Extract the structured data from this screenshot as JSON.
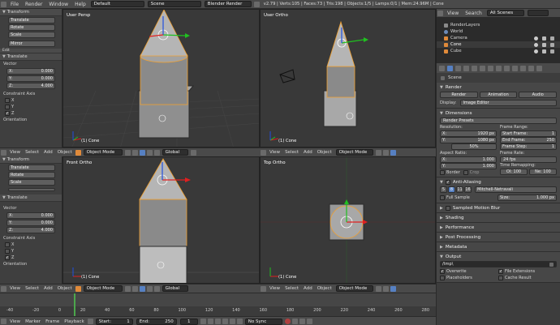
{
  "topbar": {
    "menus": [
      "File",
      "Render",
      "Window",
      "Help"
    ],
    "layout": "Default",
    "scene": "Scene",
    "engine": "Blender Render",
    "stats": "v2.79 | Verts:105 | Faces:73 | Tris:198 | Objects:1/5 | Lamps:0/1 | Mem:24.96M | Cone"
  },
  "outliner": {
    "menus": [
      "View",
      "Search"
    ],
    "filter": "All Scenes",
    "items": [
      "RenderLayers",
      "World",
      "Camera",
      "Cone",
      "Cube"
    ]
  },
  "toolshelf": {
    "title": "Transform",
    "buttons": [
      "Translate",
      "Rotate",
      "Scale"
    ],
    "mirror": "Mirror",
    "edit_label": "Edit",
    "op_title": "Translate",
    "vector_label": "Vector",
    "x_label": "X:",
    "y_label": "Y:",
    "x": "0.000",
    "y": "0.000",
    "z": "4.000",
    "z_label": "Z:",
    "constraint": "Constraint Axis",
    "axes": [
      "X",
      "Y",
      "Z"
    ],
    "orientation": "Orientation"
  },
  "toolshelf2": {
    "title": "Transform",
    "buttons": [
      "Translate",
      "Rotate",
      "Scale"
    ],
    "mirror": "Mirror",
    "op_title": "Translate",
    "vector_label": "Vector",
    "x": "0.000",
    "y": "0.000",
    "z": "4.000",
    "constraint": "Constraint Axis",
    "axes": [
      "X",
      "Y",
      "Z"
    ],
    "orientation": "Orientation"
  },
  "viewports": {
    "tl": "User Persp",
    "tr": "User Ortho",
    "bl": "Front Ortho",
    "br": "Top Ortho",
    "object": "(1) Cone"
  },
  "vpheader": {
    "menus": [
      "View",
      "Select",
      "Add",
      "Object"
    ],
    "mode": "Object Mode",
    "orientation": "Global"
  },
  "props": {
    "scene_label": "Scene",
    "render_title": "Render",
    "render_buttons": [
      "Render",
      "Animation",
      "Audio"
    ],
    "display_label": "Display:",
    "display_value": "Image Editor",
    "dimensions_title": "Dimensions",
    "presets": "Render Presets",
    "resolution": "Resolution:",
    "res_x": "1920 px",
    "res_y": "1080 px",
    "res_pct": "50%",
    "aspect": "Aspect Ratio:",
    "asp_x": "1.000",
    "asp_y": "1.000",
    "border": "Border",
    "crop": "Crop",
    "frame_range": "Frame Range:",
    "start": "Start Frame:",
    "start_v": "1",
    "end": "End Frame:",
    "end_v": "250",
    "step": "Frame Step:",
    "step_v": "1",
    "frame_rate": "Frame Rate:",
    "fps": "24 fps",
    "remap": "Time Remapping:",
    "old": "Ol: 100",
    "new": "Ne: 100",
    "aa": "Anti-Aliasing",
    "aa_vals": [
      "5",
      "8",
      "11",
      "16"
    ],
    "filter": "Mitchell-Netravali",
    "full_sample": "Full Sample",
    "size": "Size:",
    "size_v": "1.000 px",
    "smb": "Sampled Motion Blur",
    "shading": "Shading",
    "performance": "Performance",
    "post": "Post Processing",
    "metadata": "Metadata",
    "output": "Output",
    "path": "/tmp\\",
    "overwrite": "Overwrite",
    "file_ext": "File Extensions",
    "placeholders": "Placeholders",
    "cache": "Cache Result"
  },
  "timeline": {
    "ticks": [
      "-40",
      "-20",
      "0",
      "20",
      "40",
      "60",
      "80",
      "100",
      "120",
      "140",
      "160",
      "180",
      "200",
      "220",
      "240",
      "260",
      "280"
    ],
    "menus": [
      "View",
      "Marker",
      "Frame",
      "Playback"
    ],
    "start": "Start:",
    "start_v": "1",
    "end": "End:",
    "end_v": "250",
    "frame": "1",
    "sync": "No Sync"
  },
  "colors": {
    "accent": "#5680c2",
    "x_axis": "#e02020",
    "y_axis": "#20c020",
    "z_axis": "#2050e0"
  }
}
